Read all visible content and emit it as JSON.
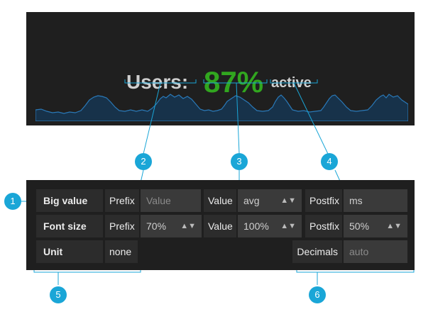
{
  "singlestat": {
    "prefix": "Users:",
    "value": "87%",
    "postfix": "active",
    "colors": {
      "value": "#31a61f",
      "text": "#cfcfcf",
      "background": "#1f1f1f",
      "sparkline": "#1f6ea6"
    }
  },
  "editor": {
    "big_value": {
      "label": "Big value",
      "prefix_label": "Prefix",
      "prefix_placeholder": "Value",
      "value_label": "Value",
      "value_selected": "avg",
      "postfix_label": "Postfix",
      "postfix_value": "ms"
    },
    "font_size": {
      "label": "Font size",
      "prefix_label": "Prefix",
      "prefix_selected": "70%",
      "value_label": "Value",
      "value_selected": "100%",
      "postfix_label": "Postfix",
      "postfix_selected": "50%"
    },
    "unit": {
      "label": "Unit",
      "selected": "none",
      "decimals_label": "Decimals",
      "decimals_placeholder": "auto"
    }
  },
  "callouts": [
    "1",
    "2",
    "3",
    "4",
    "5",
    "6"
  ],
  "accent_color": "#1aa6d7"
}
